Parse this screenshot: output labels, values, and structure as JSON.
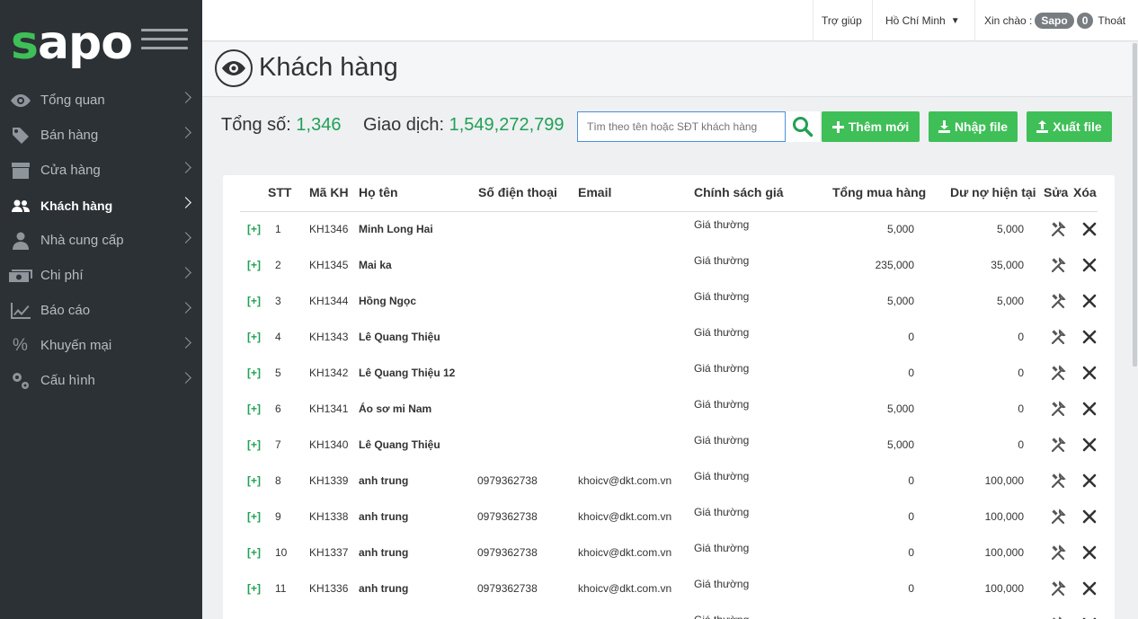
{
  "sidebar": {
    "logo": {
      "s": "s",
      "rest": "apo"
    },
    "items": [
      {
        "label": "Tổng quan",
        "icon": "eye-icon"
      },
      {
        "label": "Bán hàng",
        "icon": "tag-icon"
      },
      {
        "label": "Cửa hàng",
        "icon": "store-icon"
      },
      {
        "label": "Khách hàng",
        "icon": "users-icon",
        "active": true
      },
      {
        "label": "Nhà cung cấp",
        "icon": "supplier-icon"
      },
      {
        "label": "Chi phí",
        "icon": "money-icon"
      },
      {
        "label": "Báo cáo",
        "icon": "chart-icon"
      },
      {
        "label": "Khuyến mại",
        "icon": "percent-icon"
      },
      {
        "label": "Cấu hình",
        "icon": "gear-icon"
      }
    ]
  },
  "topbar": {
    "help": "Trợ giúp",
    "location": "Hồ Chí Minh",
    "greeting": "Xin chào :",
    "user": "Sapo",
    "notifications": "0",
    "logout": "Thoát"
  },
  "page": {
    "title": "Khách hàng",
    "total_label": "Tổng số:",
    "total_value": "1,346",
    "trans_label": "Giao dịch:",
    "trans_value": "1,549,272,799"
  },
  "toolbar": {
    "search_placeholder": "Tìm theo tên hoặc SĐT khách hàng",
    "add_label": "Thêm mới",
    "import_label": "Nhập file",
    "export_label": "Xuất file"
  },
  "table": {
    "headers": {
      "stt": "STT",
      "code": "Mã KH",
      "name": "Họ tên",
      "phone": "Số điện thoại",
      "email": "Email",
      "policy": "Chính sách giá",
      "total": "Tổng mua hàng",
      "debt": "Dư nợ hiện tại",
      "edit": "Sửa",
      "delete": "Xóa"
    },
    "expand_label": "[+]",
    "rows": [
      {
        "stt": "1",
        "code": "KH1346",
        "name": "Minh Long Hai",
        "phone": "",
        "email": "",
        "policy": "Giá thường",
        "total": "5,000",
        "debt": "5,000"
      },
      {
        "stt": "2",
        "code": "KH1345",
        "name": "Mai ka",
        "phone": "",
        "email": "",
        "policy": "Giá thường",
        "total": "235,000",
        "debt": "35,000"
      },
      {
        "stt": "3",
        "code": "KH1344",
        "name": "Hồng Ngọc",
        "phone": "",
        "email": "",
        "policy": "Giá thường",
        "total": "5,000",
        "debt": "5,000"
      },
      {
        "stt": "4",
        "code": "KH1343",
        "name": "Lê Quang Thiệu",
        "phone": "",
        "email": "",
        "policy": "Giá thường",
        "total": "0",
        "debt": "0"
      },
      {
        "stt": "5",
        "code": "KH1342",
        "name": "Lê Quang Thiệu 12",
        "phone": "",
        "email": "",
        "policy": "Giá thường",
        "total": "0",
        "debt": "0"
      },
      {
        "stt": "6",
        "code": "KH1341",
        "name": "Áo sơ mi Nam",
        "phone": "",
        "email": "",
        "policy": "Giá thường",
        "total": "5,000",
        "debt": "0"
      },
      {
        "stt": "7",
        "code": "KH1340",
        "name": "Lê Quang Thiệu",
        "phone": "",
        "email": "",
        "policy": "Giá thường",
        "total": "5,000",
        "debt": "0"
      },
      {
        "stt": "8",
        "code": "KH1339",
        "name": "anh trung",
        "phone": "0979362738",
        "email": "khoicv@dkt.com.vn",
        "policy": "Giá thường",
        "total": "0",
        "debt": "100,000"
      },
      {
        "stt": "9",
        "code": "KH1338",
        "name": "anh trung",
        "phone": "0979362738",
        "email": "khoicv@dkt.com.vn",
        "policy": "Giá thường",
        "total": "0",
        "debt": "100,000"
      },
      {
        "stt": "10",
        "code": "KH1337",
        "name": "anh trung",
        "phone": "0979362738",
        "email": "khoicv@dkt.com.vn",
        "policy": "Giá thường",
        "total": "0",
        "debt": "100,000"
      },
      {
        "stt": "11",
        "code": "KH1336",
        "name": "anh trung",
        "phone": "0979362738",
        "email": "khoicv@dkt.com.vn",
        "policy": "Giá thường",
        "total": "0",
        "debt": "100,000"
      },
      {
        "stt": "",
        "code": "",
        "name": "",
        "phone": "",
        "email": "",
        "policy": "Giá thường",
        "total": "",
        "debt": ""
      }
    ]
  },
  "colors": {
    "accent": "#3fbf57",
    "value_green": "#21a055",
    "sidebar_bg": "#2c3136"
  }
}
